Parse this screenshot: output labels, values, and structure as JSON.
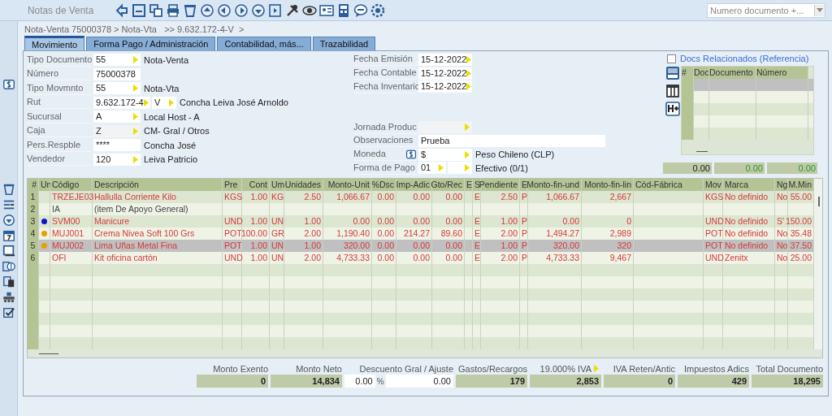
{
  "window": {
    "title": "Notas de Venta",
    "search": {
      "placeholder": "Numero documento +..."
    }
  },
  "breadcrumb": "Nota-Venta 75000378 > Nota-Vta   >> 9.632.172-4-V  >",
  "tabs": [
    {
      "label": "Movimiento",
      "selected": true
    },
    {
      "label": "Forma Pago / Administración",
      "selected": false
    },
    {
      "label": "Contabilidad, más...",
      "selected": false
    },
    {
      "label": "Trazabilidad",
      "selected": false
    }
  ],
  "form": {
    "left": [
      {
        "label": "Tipo Documento",
        "inputs": [
          {
            "value": "55",
            "lookup": true,
            "disabled": false
          }
        ],
        "description": "Nota-Venta"
      },
      {
        "label": "Número",
        "inputs": [
          {
            "value": "75000378",
            "lookup": false,
            "disabled": false
          }
        ]
      },
      {
        "label": "Tipo Movmnto",
        "inputs": [
          {
            "value": "55",
            "lookup": true,
            "disabled": false
          }
        ],
        "description": "Nota-Vta"
      },
      {
        "label": "Rut",
        "inputs": [
          {
            "value": "9.632.172-4",
            "lookup": true,
            "disabled": false
          },
          {
            "value": "V",
            "lookup": true,
            "disabled": false
          }
        ],
        "description": "Concha Leiva José Arnoldo"
      },
      {
        "label": "Sucursal",
        "inputs": [
          {
            "value": "A",
            "lookup": true,
            "disabled": false
          }
        ],
        "description": "Local Host - A"
      },
      {
        "label": "Caja",
        "inputs": [
          {
            "value": "Z",
            "lookup": true,
            "disabled": true
          }
        ],
        "description": "CM- Gral / Otros"
      },
      {
        "label": "Pers.Respble",
        "inputs": [
          {
            "value": "****",
            "lookup": false,
            "disabled": false
          }
        ],
        "description": "Concha José"
      },
      {
        "label": "Vendedor",
        "inputs": [
          {
            "value": "120",
            "lookup": true,
            "disabled": false
          }
        ],
        "description": "Leiva Patricio"
      }
    ],
    "dates": [
      {
        "label": "Fecha Emisión",
        "kind": "date",
        "inputs": [
          {
            "value": "15-12-2022",
            "lookup": true,
            "disabled": false
          }
        ]
      },
      {
        "label": "Fecha Contable",
        "kind": "date",
        "inputs": [
          {
            "value": "15-12-2022",
            "lookup": true,
            "disabled": false
          }
        ]
      },
      {
        "label": "Fecha Inventario",
        "kind": "date",
        "inputs": [
          {
            "value": "15-12-2022",
            "lookup": true,
            "disabled": false
          }
        ]
      }
    ],
    "details": [
      {
        "label": "Jornada Produc",
        "kind": "lookup",
        "inputs": [
          {
            "lookup": true,
            "disabled": true
          }
        ]
      },
      {
        "label": "Observaciones",
        "kind": "text",
        "inputs": [
          {
            "value": "Prueba",
            "lookup": false,
            "disabled": false
          }
        ]
      },
      {
        "label": "Moneda",
        "kind": "currency",
        "inputs": [
          {
            "value": "$",
            "lookup": true,
            "disabled": false
          }
        ],
        "description": "Peso Chileno (CLP)"
      },
      {
        "label": "Forma de Pago",
        "kind": "lookup",
        "inputs": [
          {
            "value": "01",
            "lookup": true,
            "disabled": false
          },
          {
            "lookup": true,
            "disabled": false
          }
        ],
        "description": "Efectivo (0/1)"
      }
    ]
  },
  "related_docs": {
    "checked": false,
    "title": "Docs Relacionados (Referencia)",
    "columns": [
      "#",
      "Doc",
      "Documento",
      "Número"
    ],
    "totals": [
      {
        "value": "0.00",
        "kind": "neutral"
      },
      {
        "value": "0.00",
        "kind": "positive"
      },
      {
        "value": "0.00",
        "kind": "positive"
      }
    ]
  },
  "table": {
    "columns": [
      "#",
      "Un",
      "Código",
      "Descripción",
      "Pre",
      "Cont",
      "Um",
      "Unidades",
      "Monto-Unit",
      "%Dsc",
      "Imp-Adic",
      "Gto/Rec",
      "E",
      "S",
      "Pendiente",
      "E.",
      "Monto-fin-und",
      "Monto-fin-lin",
      "Cód-Fábrica",
      "Mov",
      "Marca",
      "Ng",
      "M.Min"
    ],
    "rows": [
      {
        "kind": "item",
        "selected": false,
        "cells": [
          "1",
          null,
          "TRZEJE03",
          "Hallulla Corriente Kilo",
          "KGS",
          "1.00",
          "KG",
          "2.50",
          "1,066.67",
          "0.00",
          "0.00",
          "0.00",
          null,
          "E",
          "2.50",
          "P",
          "1,066.67",
          "2,667",
          null,
          "KGS",
          "No definido",
          "No",
          "55.00"
        ]
      },
      {
        "kind": "note",
        "selected": false,
        "cells": [
          "2",
          null,
          "IA",
          "(item De Apoyo General)",
          null,
          null,
          null,
          null,
          null,
          null,
          null,
          null,
          null,
          null,
          null,
          null,
          null,
          null,
          null,
          null,
          null,
          null,
          null
        ]
      },
      {
        "kind": "item",
        "selected": false,
        "color": "#1010d0",
        "cells": [
          "3",
          null,
          "SVM00",
          "Manicure",
          "UND",
          "1.00",
          "UN",
          "1.00",
          "0.00",
          "0.00",
          "0.00",
          "0.00",
          null,
          "E",
          "1.00",
          "P",
          "0.00",
          "0",
          null,
          "UND",
          "No definido",
          "S'",
          "150.00"
        ]
      },
      {
        "kind": "item",
        "selected": false,
        "color": "#e8a000",
        "cells": [
          "4",
          null,
          "MUJ001",
          "Crema Nivea Soft 100 Grs",
          "POT",
          "100.00",
          "GR",
          "2.00",
          "1,190.40",
          "0.00",
          "214.27",
          "89.60",
          null,
          "E",
          "2.00",
          "P",
          "1,494.27",
          "2,989",
          null,
          "POT",
          "No definido",
          "No",
          "35.48"
        ]
      },
      {
        "kind": "item",
        "selected": true,
        "color": "#e8a000",
        "cells": [
          "5",
          null,
          "MUJ002",
          "Lima Uñas Metal Fina",
          "POT",
          "1.00",
          "UN",
          "1.00",
          "320.00",
          "0.00",
          "0.00",
          "0.00",
          null,
          "E",
          "1.00",
          "P",
          "320.00",
          "320",
          null,
          "POT",
          "No definido",
          "No",
          "37.50"
        ]
      },
      {
        "kind": "item",
        "selected": false,
        "cells": [
          "6",
          null,
          "OFI",
          "Kit oficina cartón",
          "UND",
          "1.00",
          "UN",
          "2.00",
          "4,733.33",
          "0.00",
          "0.00",
          "0.00",
          null,
          "E",
          "2.00",
          "P",
          "4,733.33",
          "9,467",
          null,
          "UND",
          "Zenitx",
          "No",
          "25.00"
        ]
      }
    ]
  },
  "totals": [
    {
      "kind": "amount",
      "label": "Monto Exento",
      "value": "0"
    },
    {
      "kind": "amount",
      "label": "Monto Neto",
      "value": "14,834"
    },
    {
      "kind": "discount",
      "label": "Descuento Gral / Ajuste",
      "percent": "0.00",
      "unit": "%",
      "value": "0.00"
    },
    {
      "kind": "amount",
      "label": "Gastos/Recargos",
      "value": "179"
    },
    {
      "kind": "lookup",
      "label": "19.000% IVA",
      "value": "2,853"
    },
    {
      "kind": "amount",
      "label": "IVA Reten/Antic",
      "value": "0"
    },
    {
      "kind": "amount",
      "label": "Impuestos Adics",
      "value": "429"
    },
    {
      "kind": "amount",
      "label": "Total Documento",
      "value": "18,295"
    }
  ]
}
